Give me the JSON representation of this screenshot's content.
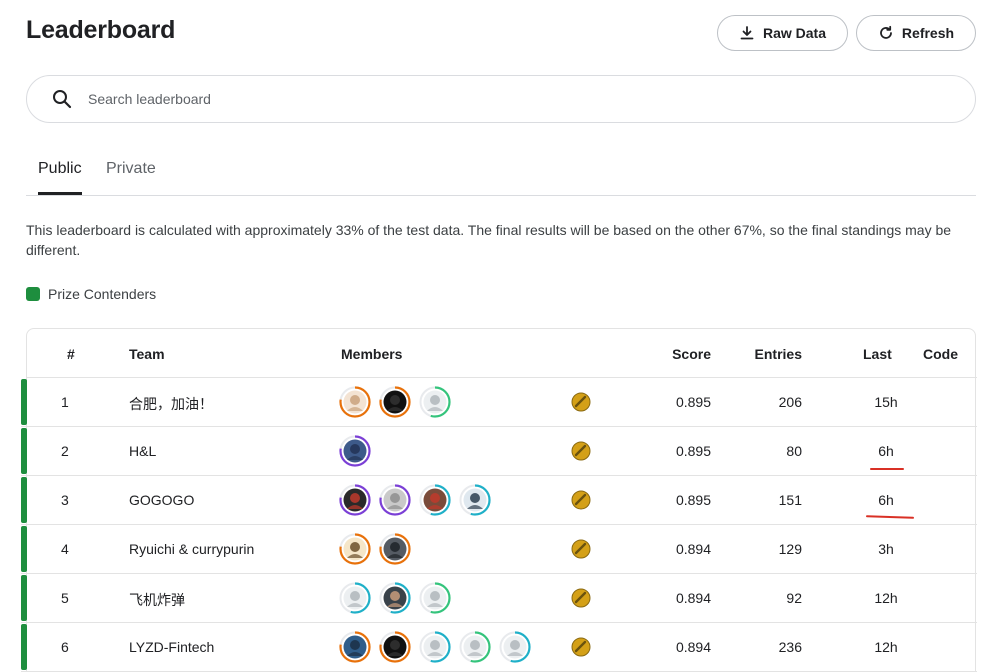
{
  "header": {
    "title": "Leaderboard",
    "raw_data_label": "Raw Data",
    "refresh_label": "Refresh"
  },
  "search": {
    "placeholder": "Search leaderboard"
  },
  "tabs": [
    {
      "label": "Public",
      "active": true
    },
    {
      "label": "Private",
      "active": false
    }
  ],
  "info_text": "This leaderboard is calculated with approximately 33% of the test data. The final results will be based on the other 67%, so the final standings may be different.",
  "legend": {
    "label": "Prize Contenders",
    "color": "#1e8e3e"
  },
  "columns": {
    "rank": "#",
    "team": "Team",
    "members": "Members",
    "score": "Score",
    "entries": "Entries",
    "last": "Last",
    "code": "Code"
  },
  "colors": {
    "ring_orange": "#e8710a",
    "ring_purple": "#7b3fd6",
    "ring_teal": "#1fb0c8",
    "ring_green": "#34c47c",
    "medal_gold": "#d4a017",
    "annotation_red": "#d93025"
  },
  "rows": [
    {
      "rank": "1",
      "team": "合肥，加油！",
      "score": "0.895",
      "entries": "206",
      "last": "15h",
      "members": [
        {
          "icon": "cat-avatar",
          "ring": "orange"
        },
        {
          "icon": "dark-avatar",
          "ring": "orange"
        },
        {
          "icon": "goose-avatar",
          "ring": "green"
        }
      ]
    },
    {
      "rank": "2",
      "team": "H&L",
      "score": "0.895",
      "entries": "80",
      "last": "6h",
      "members": [
        {
          "icon": "owl-avatar",
          "ring": "purple"
        }
      ]
    },
    {
      "rank": "3",
      "team": "GOGOGO",
      "score": "0.895",
      "entries": "151",
      "last": "6h",
      "members": [
        {
          "icon": "red-avatar",
          "ring": "purple"
        },
        {
          "icon": "gray-avatar",
          "ring": "purple"
        },
        {
          "icon": "brown-avatar",
          "ring": "teal"
        },
        {
          "icon": "penguin-avatar",
          "ring": "teal"
        }
      ]
    },
    {
      "rank": "4",
      "team": "Ryuichi & currypurin",
      "score": "0.894",
      "entries": "129",
      "last": "3h",
      "members": [
        {
          "icon": "face-avatar",
          "ring": "orange"
        },
        {
          "icon": "guitar-avatar",
          "ring": "orange"
        }
      ]
    },
    {
      "rank": "5",
      "team": "飞机炸弹",
      "score": "0.894",
      "entries": "92",
      "last": "12h",
      "members": [
        {
          "icon": "goose-avatar",
          "ring": "teal"
        },
        {
          "icon": "person-avatar",
          "ring": "teal"
        },
        {
          "icon": "goose-avatar",
          "ring": "green"
        }
      ]
    },
    {
      "rank": "6",
      "team": "LYZD-Fintech",
      "score": "0.894",
      "entries": "236",
      "last": "12h",
      "members": [
        {
          "icon": "blue-avatar",
          "ring": "orange"
        },
        {
          "icon": "dark-avatar",
          "ring": "orange"
        },
        {
          "icon": "goose-avatar",
          "ring": "teal"
        },
        {
          "icon": "goose-avatar",
          "ring": "green"
        },
        {
          "icon": "goose-avatar",
          "ring": "teal"
        }
      ]
    }
  ]
}
